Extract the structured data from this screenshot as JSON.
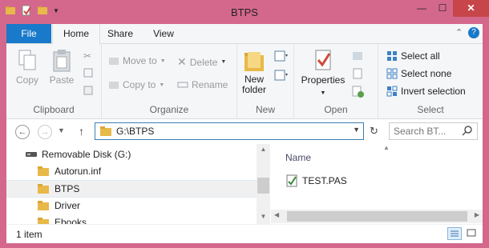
{
  "window": {
    "title": "BTPS",
    "minimize_glyph": "—",
    "maximize_glyph": "☐",
    "close_glyph": "✕"
  },
  "ribbon_tabs": [
    "File",
    "Home",
    "Share",
    "View"
  ],
  "ribbon": {
    "clipboard": {
      "copy": "Copy",
      "paste": "Paste",
      "label": "Clipboard"
    },
    "organize": {
      "move_to": "Move to",
      "copy_to": "Copy to",
      "delete": "Delete",
      "rename": "Rename",
      "label": "Organize"
    },
    "new": {
      "new_folder_line1": "New",
      "new_folder_line2": "folder",
      "label": "New"
    },
    "open": {
      "properties": "Properties",
      "label": "Open"
    },
    "select": {
      "select_all": "Select all",
      "select_none": "Select none",
      "invert": "Invert selection",
      "label": "Select"
    }
  },
  "address": {
    "path": "G:\\BTPS"
  },
  "search": {
    "placeholder": "Search BT..."
  },
  "tree": {
    "root": "Removable Disk (G:)",
    "items": [
      "Autorun.inf",
      "BTPS",
      "Driver",
      "Ebooks"
    ],
    "selected_index": 1
  },
  "files": {
    "column_name": "Name",
    "items": [
      "TEST.PAS"
    ]
  },
  "status": {
    "text": "1 item"
  },
  "colors": {
    "accent": "#1979ca",
    "frame": "#d4688c",
    "close": "#c7464a",
    "folder": "#e8b948"
  }
}
